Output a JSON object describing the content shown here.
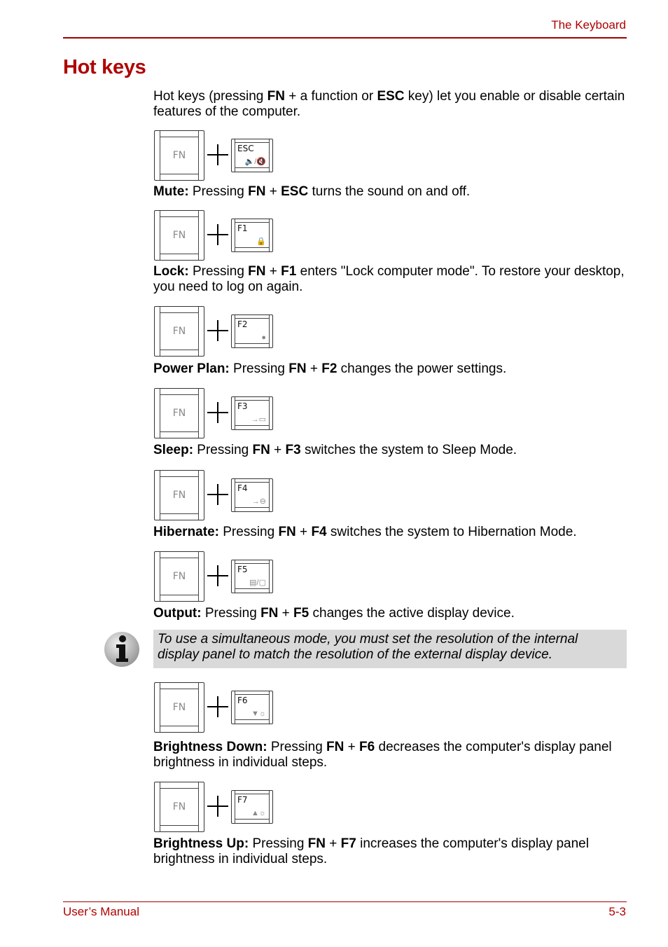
{
  "header": {
    "section": "The Keyboard"
  },
  "title": "Hot keys",
  "intro": {
    "t1": "Hot keys (pressing ",
    "b1": "FN",
    "t2": " + a function or ",
    "b2": "ESC",
    "t3": " key) let you enable or disable certain features of the computer."
  },
  "fn_label": "FN",
  "hotkeys": [
    {
      "key": "ESC",
      "icon": "speaker-mute-icon",
      "glyph": "🔈/🔇",
      "name": "Mute:",
      "desc_pre": " Pressing ",
      "fn": "FN",
      "plus": " + ",
      "k": "ESC",
      "desc": " turns the sound on and off."
    },
    {
      "key": "F1",
      "icon": "lock-icon",
      "glyph": "🔒",
      "name": "Lock:",
      "desc_pre": " Pressing ",
      "fn": "FN",
      "plus": " + ",
      "k": "F1",
      "desc": " enters \"Lock computer mode\". To restore your desktop, you need to log on again."
    },
    {
      "key": "F2",
      "icon": "power-plan-icon",
      "glyph": "●",
      "name": "Power Plan:",
      "desc_pre": " Pressing ",
      "fn": "FN",
      "plus": " + ",
      "k": "F2",
      "desc": " changes the power settings."
    },
    {
      "key": "F3",
      "icon": "sleep-icon",
      "glyph": "→▭",
      "name": "Sleep:",
      "desc_pre": " Pressing ",
      "fn": "FN",
      "plus": " + ",
      "k": "F3",
      "desc": " switches the system to Sleep Mode."
    },
    {
      "key": "F4",
      "icon": "hibernate-icon",
      "glyph": "→⊖",
      "name": "Hibernate:",
      "desc_pre": " Pressing ",
      "fn": "FN",
      "plus": " + ",
      "k": "F4",
      "desc": " switches the system to Hibernation Mode."
    },
    {
      "key": "F5",
      "icon": "display-output-icon",
      "glyph": "▤/▢",
      "name": "Output:",
      "desc_pre": " Pressing ",
      "fn": "FN",
      "plus": " + ",
      "k": "F5",
      "desc": " changes the active display device."
    },
    {
      "key": "F6",
      "icon": "brightness-down-icon",
      "glyph": "▼☼",
      "name": "Brightness Down:",
      "desc_pre": " Pressing ",
      "fn": "FN",
      "plus": " + ",
      "k": "F6",
      "desc": " decreases the computer's display panel brightness in individual steps."
    },
    {
      "key": "F7",
      "icon": "brightness-up-icon",
      "glyph": "▲☼",
      "name": "Brightness Up:",
      "desc_pre": " Pressing ",
      "fn": "FN",
      "plus": " + ",
      "k": "F7",
      "desc": " increases the computer's display panel brightness in individual steps."
    }
  ],
  "note": "To use a simultaneous mode, you must set the resolution of the internal display panel to match the resolution of the external display device.",
  "footer": {
    "left": "User’s Manual",
    "right": "5-3"
  },
  "colors": {
    "brand": "#b00000",
    "note_bg": "#d9d9d9"
  }
}
